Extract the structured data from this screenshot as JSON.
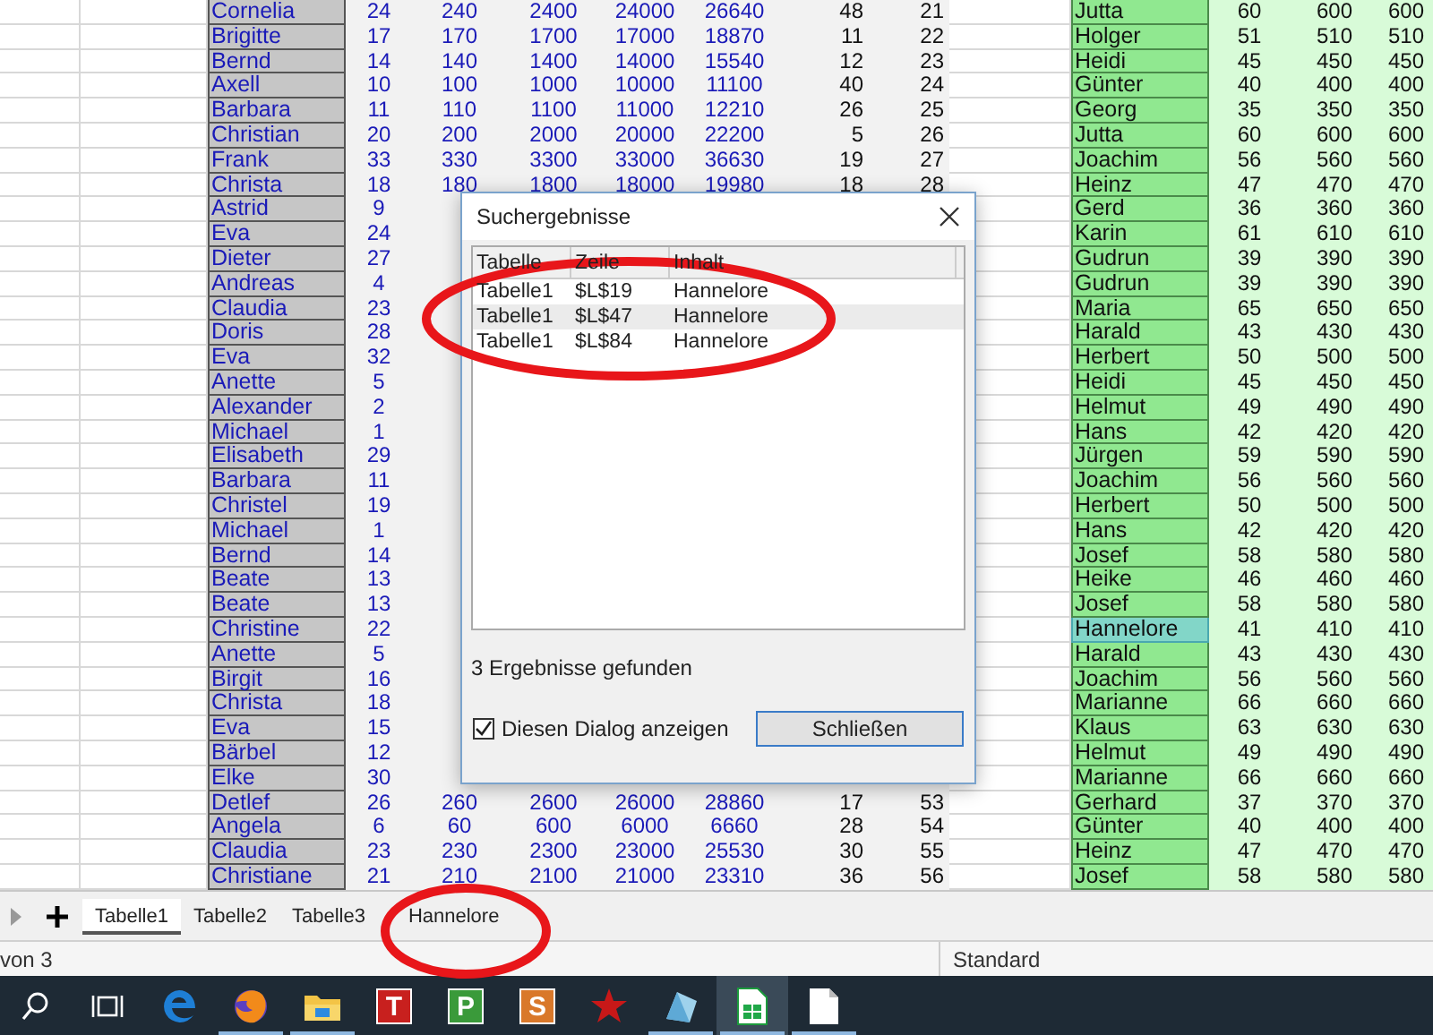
{
  "sheet": {
    "left_rows": [
      {
        "name": "Cornelia",
        "values": [
          "24",
          "240",
          "2400",
          "24000",
          "26640",
          "48",
          "21"
        ]
      },
      {
        "name": "Brigitte",
        "values": [
          "17",
          "170",
          "1700",
          "17000",
          "18870",
          "11",
          "22"
        ]
      },
      {
        "name": "Bernd",
        "values": [
          "14",
          "140",
          "1400",
          "14000",
          "15540",
          "12",
          "23"
        ]
      },
      {
        "name": "Axell",
        "values": [
          "10",
          "100",
          "1000",
          "10000",
          "11100",
          "40",
          "24"
        ]
      },
      {
        "name": "Barbara",
        "values": [
          "11",
          "110",
          "1100",
          "11000",
          "12210",
          "26",
          "25"
        ]
      },
      {
        "name": "Christian",
        "values": [
          "20",
          "200",
          "2000",
          "20000",
          "22200",
          "5",
          "26"
        ]
      },
      {
        "name": "Frank",
        "values": [
          "33",
          "330",
          "3300",
          "33000",
          "36630",
          "19",
          "27"
        ]
      },
      {
        "name": "Christa",
        "values": [
          "18",
          "180",
          "1800",
          "18000",
          "19980",
          "18",
          "28"
        ]
      },
      {
        "name": "Astrid",
        "values": [
          "9"
        ]
      },
      {
        "name": "Eva",
        "values": [
          "24"
        ]
      },
      {
        "name": "Dieter",
        "values": [
          "27"
        ]
      },
      {
        "name": "Andreas",
        "values": [
          "4"
        ]
      },
      {
        "name": "Claudia",
        "values": [
          "23"
        ]
      },
      {
        "name": "Doris",
        "values": [
          "28"
        ]
      },
      {
        "name": "Eva",
        "values": [
          "32"
        ]
      },
      {
        "name": "Anette",
        "values": [
          "5"
        ]
      },
      {
        "name": "Alexander",
        "values": [
          "2"
        ]
      },
      {
        "name": "Michael",
        "values": [
          "1"
        ]
      },
      {
        "name": "Elisabeth",
        "values": [
          "29"
        ]
      },
      {
        "name": "Barbara",
        "values": [
          "11"
        ]
      },
      {
        "name": "Christel",
        "values": [
          "19"
        ]
      },
      {
        "name": "Michael",
        "values": [
          "1"
        ]
      },
      {
        "name": "Bernd",
        "values": [
          "14"
        ]
      },
      {
        "name": "Beate",
        "values": [
          "13"
        ]
      },
      {
        "name": "Beate",
        "values": [
          "13"
        ]
      },
      {
        "name": "Christine",
        "values": [
          "22"
        ]
      },
      {
        "name": "Anette",
        "values": [
          "5"
        ]
      },
      {
        "name": "Birgit",
        "values": [
          "16"
        ]
      },
      {
        "name": "Christa",
        "values": [
          "18"
        ]
      },
      {
        "name": "Eva",
        "values": [
          "15"
        ]
      },
      {
        "name": "Bärbel",
        "values": [
          "12"
        ]
      },
      {
        "name": "Elke",
        "values": [
          "30"
        ]
      },
      {
        "name": "Detlef",
        "values": [
          "26",
          "260",
          "2600",
          "26000",
          "28860",
          "17",
          "53"
        ]
      },
      {
        "name": "Angela",
        "values": [
          "6",
          "60",
          "600",
          "6000",
          "6660",
          "28",
          "54"
        ]
      },
      {
        "name": "Claudia",
        "values": [
          "23",
          "230",
          "2300",
          "23000",
          "25530",
          "30",
          "55"
        ]
      },
      {
        "name": "Christiane",
        "values": [
          "21",
          "210",
          "2100",
          "21000",
          "23310",
          "36",
          "56"
        ]
      }
    ],
    "right_rows": [
      {
        "name": "Jutta",
        "values": [
          "60",
          "600",
          "600"
        ],
        "selected": false
      },
      {
        "name": "Holger",
        "values": [
          "51",
          "510",
          "510"
        ],
        "selected": false
      },
      {
        "name": "Heidi",
        "values": [
          "45",
          "450",
          "450"
        ],
        "selected": false
      },
      {
        "name": "Günter",
        "values": [
          "40",
          "400",
          "400"
        ],
        "selected": false
      },
      {
        "name": "Georg",
        "values": [
          "35",
          "350",
          "350"
        ],
        "selected": false
      },
      {
        "name": "Jutta",
        "values": [
          "60",
          "600",
          "600"
        ],
        "selected": false
      },
      {
        "name": "Joachim",
        "values": [
          "56",
          "560",
          "560"
        ],
        "selected": false
      },
      {
        "name": "Heinz",
        "values": [
          "47",
          "470",
          "470"
        ],
        "selected": false
      },
      {
        "name": "Gerd",
        "values": [
          "36",
          "360",
          "360"
        ],
        "selected": false
      },
      {
        "name": "Karin",
        "values": [
          "61",
          "610",
          "610"
        ],
        "selected": false
      },
      {
        "name": "Gudrun",
        "values": [
          "39",
          "390",
          "390"
        ],
        "selected": false
      },
      {
        "name": "Gudrun",
        "values": [
          "39",
          "390",
          "390"
        ],
        "selected": false
      },
      {
        "name": "Maria",
        "values": [
          "65",
          "650",
          "650"
        ],
        "selected": false
      },
      {
        "name": "Harald",
        "values": [
          "43",
          "430",
          "430"
        ],
        "selected": false
      },
      {
        "name": "Herbert",
        "values": [
          "50",
          "500",
          "500"
        ],
        "selected": false
      },
      {
        "name": "Heidi",
        "values": [
          "45",
          "450",
          "450"
        ],
        "selected": false
      },
      {
        "name": "Helmut",
        "values": [
          "49",
          "490",
          "490"
        ],
        "selected": false
      },
      {
        "name": "Hans",
        "values": [
          "42",
          "420",
          "420"
        ],
        "selected": false
      },
      {
        "name": "Jürgen",
        "values": [
          "59",
          "590",
          "590"
        ],
        "selected": false
      },
      {
        "name": "Joachim",
        "values": [
          "56",
          "560",
          "560"
        ],
        "selected": false
      },
      {
        "name": "Herbert",
        "values": [
          "50",
          "500",
          "500"
        ],
        "selected": false
      },
      {
        "name": "Hans",
        "values": [
          "42",
          "420",
          "420"
        ],
        "selected": false
      },
      {
        "name": "Josef",
        "values": [
          "58",
          "580",
          "580"
        ],
        "selected": false
      },
      {
        "name": "Heike",
        "values": [
          "46",
          "460",
          "460"
        ],
        "selected": false
      },
      {
        "name": "Josef",
        "values": [
          "58",
          "580",
          "580"
        ],
        "selected": false
      },
      {
        "name": "Hannelore",
        "values": [
          "41",
          "410",
          "410"
        ],
        "selected": true
      },
      {
        "name": "Harald",
        "values": [
          "43",
          "430",
          "430"
        ],
        "selected": false
      },
      {
        "name": "Joachim",
        "values": [
          "56",
          "560",
          "560"
        ],
        "selected": false
      },
      {
        "name": "Marianne",
        "values": [
          "66",
          "660",
          "660"
        ],
        "selected": false
      },
      {
        "name": "Klaus",
        "values": [
          "63",
          "630",
          "630"
        ],
        "selected": false
      },
      {
        "name": "Helmut",
        "values": [
          "49",
          "490",
          "490"
        ],
        "selected": false
      },
      {
        "name": "Marianne",
        "values": [
          "66",
          "660",
          "660"
        ],
        "selected": false
      },
      {
        "name": "Gerhard",
        "values": [
          "37",
          "370",
          "370"
        ],
        "selected": false
      },
      {
        "name": "Günter",
        "values": [
          "40",
          "400",
          "400"
        ],
        "selected": false
      },
      {
        "name": "Heinz",
        "values": [
          "47",
          "470",
          "470"
        ],
        "selected": false
      },
      {
        "name": "Josef",
        "values": [
          "58",
          "580",
          "580"
        ],
        "selected": false
      }
    ]
  },
  "dialog": {
    "title": "Suchergebnisse",
    "columns": [
      "Tabelle",
      "Zeile",
      "Inhalt"
    ],
    "rows": [
      {
        "cells": [
          "Tabelle1",
          "$L$19",
          "Hannelore"
        ],
        "selected": false
      },
      {
        "cells": [
          "Tabelle1",
          "$L$47",
          "Hannelore"
        ],
        "selected": true
      },
      {
        "cells": [
          "Tabelle1",
          "$L$84",
          "Hannelore"
        ],
        "selected": false
      }
    ],
    "summary": "3 Ergebnisse gefunden",
    "show_again": {
      "label": "Diesen Dialog anzeigen",
      "checked": true
    },
    "close_button": "Schließen"
  },
  "sheet_tabs": [
    {
      "label": "Tabelle1",
      "selected": true
    },
    {
      "label": "Tabelle2",
      "selected": false
    },
    {
      "label": "Tabelle3",
      "selected": false
    },
    {
      "label": "Hannelore",
      "selected": false
    }
  ],
  "status_bar": {
    "page": "von 3",
    "style": "Standard"
  },
  "taskbar": [
    {
      "kind": "search",
      "running": false,
      "active": false
    },
    {
      "kind": "taskview",
      "running": false,
      "active": false
    },
    {
      "kind": "edge",
      "running": false,
      "active": false
    },
    {
      "kind": "firefox",
      "running": true,
      "active": false
    },
    {
      "kind": "folder",
      "running": true,
      "active": false
    },
    {
      "kind": "letter",
      "label": "T",
      "color": "#c8201e",
      "running": false,
      "active": false
    },
    {
      "kind": "letter",
      "label": "P",
      "color": "#3a9a3a",
      "running": false,
      "active": false
    },
    {
      "kind": "letter",
      "label": "S",
      "color": "#d9782a",
      "running": false,
      "active": false
    },
    {
      "kind": "star",
      "running": false,
      "active": false
    },
    {
      "kind": "crystal",
      "running": true,
      "active": false
    },
    {
      "kind": "calc",
      "running": true,
      "active": true
    },
    {
      "kind": "document",
      "running": true,
      "active": false
    }
  ]
}
